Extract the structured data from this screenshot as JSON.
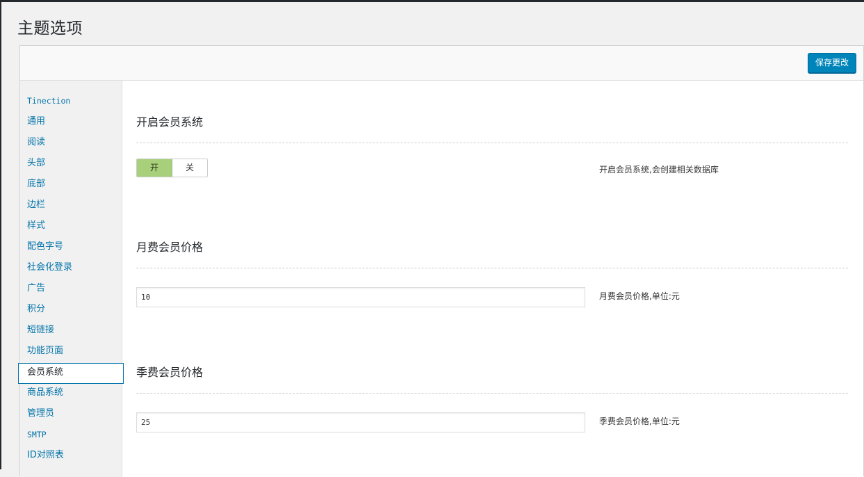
{
  "page": {
    "title": "主题选项"
  },
  "toolbar": {
    "save_label": "保存更改"
  },
  "sidebar": {
    "items": [
      {
        "label": "Tinection"
      },
      {
        "label": "通用"
      },
      {
        "label": "阅读"
      },
      {
        "label": "头部"
      },
      {
        "label": "底部"
      },
      {
        "label": "边栏"
      },
      {
        "label": "样式"
      },
      {
        "label": "配色字号"
      },
      {
        "label": "社会化登录"
      },
      {
        "label": "广告"
      },
      {
        "label": "积分"
      },
      {
        "label": "短链接"
      },
      {
        "label": "功能页面"
      },
      {
        "label": "会员系统"
      },
      {
        "label": "商品系统"
      },
      {
        "label": "管理员"
      },
      {
        "label": "SMTP"
      },
      {
        "label": "ID对照表"
      }
    ],
    "active_item": "会员系统"
  },
  "sections": {
    "membership": {
      "title": "开启会员系统",
      "toggle_on": "开",
      "toggle_off": "关",
      "selected": "开",
      "description": "开启会员系统,会创建相关数据库"
    },
    "monthly_price": {
      "title": "月费会员价格",
      "value": "10",
      "description": "月费会员价格,单位:元"
    },
    "quarterly_price": {
      "title": "季费会员价格",
      "value": "25",
      "description": "季费会员价格,单位:元"
    }
  },
  "colors": {
    "accent": "#0085ba",
    "link": "#0073aa",
    "toggle_on": "#a8d07a"
  }
}
